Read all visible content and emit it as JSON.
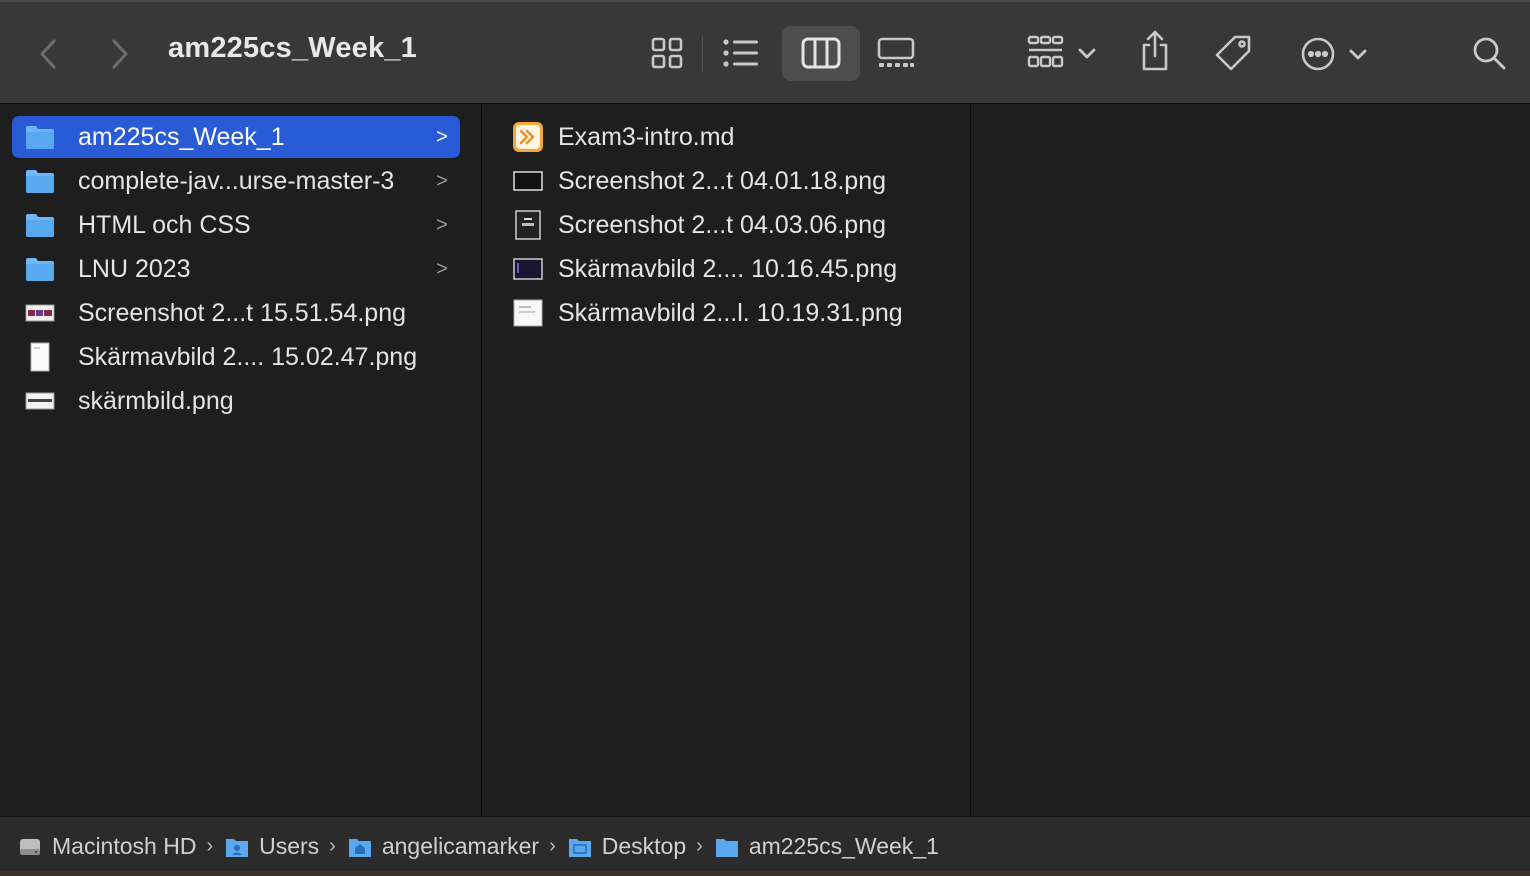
{
  "window": {
    "title": "am225cs_Week_1"
  },
  "toolbar": {
    "back_icon": "chevron-left-icon",
    "forward_icon": "chevron-right-icon",
    "views": [
      "icon-view",
      "list-view",
      "column-view",
      "gallery-view"
    ],
    "active_view": "column-view",
    "group_icon": "group-icon",
    "share_icon": "share-icon",
    "tag_icon": "tag-icon",
    "more_icon": "ellipsis-circle-icon",
    "search_icon": "search-icon"
  },
  "column1": {
    "items": [
      {
        "label": "am225cs_Week_1",
        "kind": "folder",
        "selected": true,
        "chevron": ">"
      },
      {
        "label": "complete-jav...urse-master-3",
        "kind": "folder",
        "chevron": ">"
      },
      {
        "label": "HTML och CSS",
        "kind": "folder",
        "chevron": ">"
      },
      {
        "label": "LNU 2023",
        "kind": "folder",
        "chevron": ">"
      },
      {
        "label": "Screenshot 2...t 15.51.54.png",
        "kind": "image"
      },
      {
        "label": "Skärmavbild 2.... 15.02.47.png",
        "kind": "image"
      },
      {
        "label": "skärmbild.png",
        "kind": "image"
      }
    ]
  },
  "column2": {
    "items": [
      {
        "label": "Exam3-intro.md",
        "kind": "markdown"
      },
      {
        "label": "Screenshot 2...t 04.01.18.png",
        "kind": "image"
      },
      {
        "label": "Screenshot 2...t 04.03.06.png",
        "kind": "image"
      },
      {
        "label": "Skärmavbild 2.... 10.16.45.png",
        "kind": "image"
      },
      {
        "label": "Skärmavbild 2...l. 10.19.31.png",
        "kind": "image"
      }
    ]
  },
  "pathbar": {
    "crumbs": [
      "Macintosh HD",
      "Users",
      "angelicamarker",
      "Desktop",
      "am225cs_Week_1"
    ],
    "separator": "›"
  },
  "colors": {
    "selection": "#2a5bd7",
    "folder": "#5aa9f0",
    "toolbar": "#383838",
    "background": "#1e1e1e"
  }
}
